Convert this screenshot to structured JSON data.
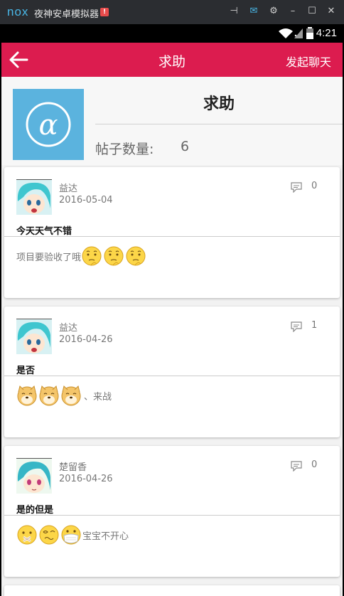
{
  "emulator": {
    "logo": "nox",
    "title": "夜神安卓模拟器",
    "badge": "!"
  },
  "status_bar": {
    "time": "4:21"
  },
  "app_bar": {
    "title": "求助",
    "chat_button": "发起聊天"
  },
  "forum": {
    "name": "求助",
    "post_count_label": "帖子数量:",
    "post_count": "6"
  },
  "posts": [
    {
      "author": "益达",
      "date": "2016-05-04",
      "comments": "0",
      "title": "今天天气不错",
      "body_text": "项目要验收了哦",
      "emojis": [
        "thinking-face-icon",
        "thinking-face-icon",
        "thinking-face-icon"
      ]
    },
    {
      "author": "益达",
      "date": "2016-04-26",
      "comments": "1",
      "title": "是否",
      "body_text": "、来战",
      "emojis": [
        "doge-icon",
        "doge-icon",
        "doge-icon"
      ]
    },
    {
      "author": "楚留香",
      "date": "2016-04-26",
      "comments": "0",
      "title": "是的但是",
      "body_text": "宝宝不开心",
      "emojis": [
        "sealed-lips-face-icon",
        "dizzy-face-icon",
        "mask-face-icon"
      ]
    }
  ],
  "colors": {
    "app_bar": "#dc1c4f",
    "forum_icon_bg": "#5bb3de",
    "emulator_bar": "#2b2d31"
  }
}
